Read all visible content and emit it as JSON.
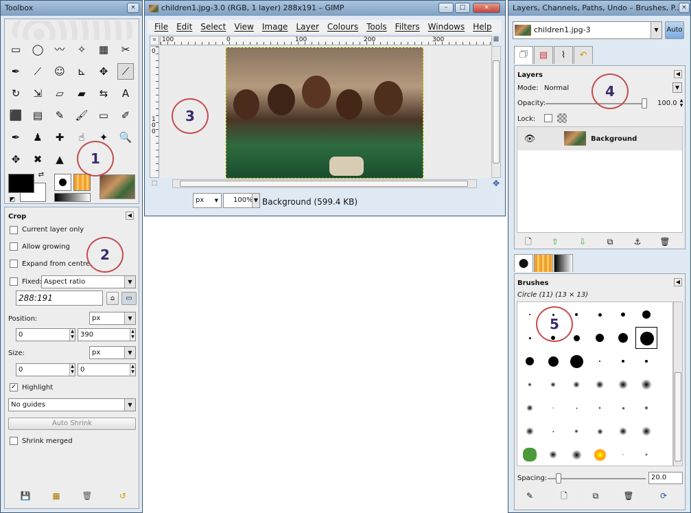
{
  "colors": {
    "title_bg": "#8fb0d1",
    "accent_blue": "#3b6fb6",
    "circle_red": "#c54b4b",
    "circle_text": "#3a2b6b"
  },
  "toolbox": {
    "title": "Toolbox",
    "close_glyph": "×",
    "tools": [
      "rect-select-icon",
      "ellipse-select-icon",
      "free-select-icon",
      "fuzzy-select-icon",
      "color-select-icon",
      "scissors-icon",
      "paths-icon",
      "color-picker-icon",
      "zoom-clone-icon",
      "measure-icon",
      "move-icon",
      "crop-icon",
      "rotate-icon",
      "scale-icon",
      "shear-icon",
      "perspective-icon",
      "flip-icon",
      "text-icon",
      "bucket-fill-icon",
      "blend-icon",
      "pencil-icon",
      "paintbrush-icon",
      "eraser-icon",
      "airbrush-icon",
      "ink-icon",
      "clone-icon",
      "heal-icon",
      "smudge-icon",
      "dodge-icon",
      "zoom-icon",
      "align-icon",
      "heal2-icon",
      "perspective-clone-icon"
    ],
    "tool_glyphs": [
      "▭",
      "◯",
      "〰",
      "✧",
      "▦",
      "✂",
      "✒",
      "⟋",
      "☺",
      "⊾",
      "✥",
      "⟋",
      "↻",
      "⇲",
      "▱",
      "▰",
      "⇆",
      "A",
      "⬛",
      "▤",
      "✎",
      "🖌",
      "▭",
      "✐",
      "✒",
      "♟",
      "✚",
      "☝",
      "✦",
      "🔍",
      "✥",
      "✖",
      "▲"
    ],
    "fg_color": "#000000",
    "bg_color": "#ffffff"
  },
  "tool_options": {
    "title": "Crop",
    "current_layer_only": "Current layer only",
    "allow_growing": "Allow growing",
    "expand_from_centre": "Expand from centre",
    "fixed_label": "Fixed:",
    "fixed_value": "Aspect ratio",
    "ratio_value": "288:191",
    "position_label": "Position:",
    "position_unit": "px",
    "position_x": "0",
    "position_y": "390",
    "size_label": "Size:",
    "size_unit": "px",
    "size_w": "0",
    "size_h": "0",
    "highlight_label": "Highlight",
    "guides_value": "No guides",
    "auto_shrink": "Auto Shrink",
    "shrink_merged": "Shrink merged",
    "footer_icons": [
      "save-icon",
      "restore-icon",
      "delete-icon",
      "reset-icon"
    ]
  },
  "image_window": {
    "title": "children1.jpg-3.0 (RGB, 1 layer) 288x191 – GIMP",
    "menu": [
      "File",
      "Edit",
      "Select",
      "View",
      "Image",
      "Layer",
      "Colours",
      "Tools",
      "Filters",
      "Windows",
      "Help"
    ],
    "ruler_marks": [
      "100",
      "0",
      "100",
      "200",
      "300"
    ],
    "vruler_marks": [
      "0",
      "1 0 0"
    ],
    "unit": "px",
    "zoom": "100%",
    "status": "Background (599.4 KB)"
  },
  "docks": {
    "title": "Layers, Channels, Paths, Undo – Brushes, P...",
    "image_select": "children1.jpg-3",
    "auto_label": "Auto",
    "layers": {
      "title": "Layers",
      "mode_label": "Mode:",
      "mode_value": "Normal",
      "opacity_label": "Opacity:",
      "opacity_value": "100.0",
      "opacity_fraction": 1.0,
      "lock_label": "Lock:",
      "layer_name": "Background"
    },
    "brushes": {
      "title": "Brushes",
      "current": "Circle (11) (13 × 13)",
      "spacing_label": "Spacing:",
      "spacing_value": "20.0",
      "spacing_fraction": 0.2
    }
  },
  "annotations": [
    "1",
    "2",
    "3",
    "4",
    "5"
  ]
}
